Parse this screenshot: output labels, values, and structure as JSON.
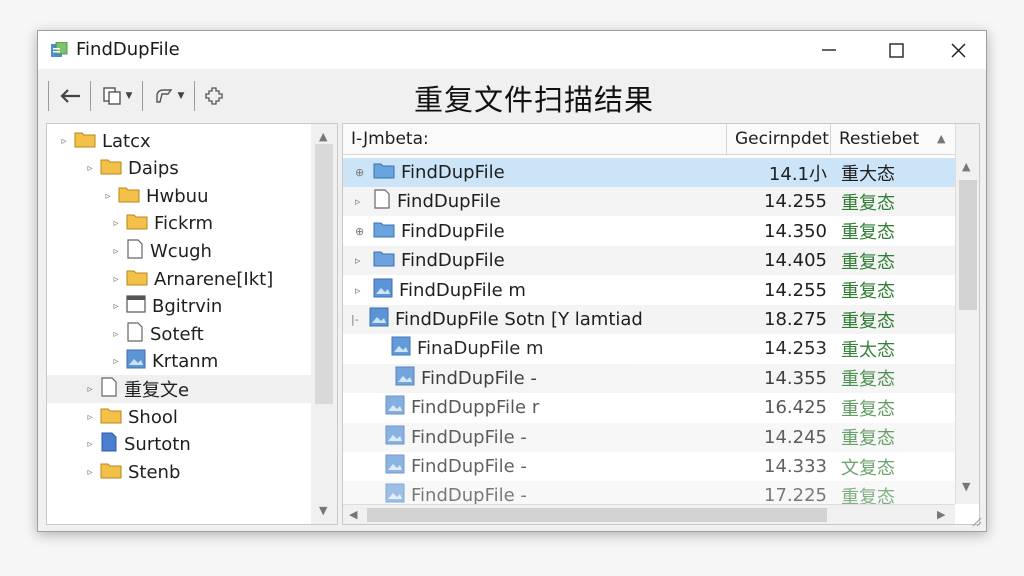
{
  "window": {
    "title": "FindDupFile"
  },
  "toolbar": {
    "heading": "重复文件扫描结果",
    "icons": [
      "back-icon",
      "copy-icon",
      "brush-icon",
      "settings-icon"
    ]
  },
  "tree": {
    "items": [
      {
        "label": "Latcx",
        "level": 0,
        "icon": "folder-icon"
      },
      {
        "label": "Daips",
        "level": 1,
        "icon": "folder-icon"
      },
      {
        "label": "Hwbuu",
        "level": 2,
        "icon": "folder-icon"
      },
      {
        "label": "Fickrm",
        "level": 3,
        "icon": "folder-icon"
      },
      {
        "label": "Wcugh",
        "level": 3,
        "icon": "file-icon"
      },
      {
        "label": "Arnarene[Ikt]",
        "level": 3,
        "icon": "folder-icon"
      },
      {
        "label": "Bgitrvin",
        "level": 3,
        "icon": "window-icon"
      },
      {
        "label": "Soteft",
        "level": 3,
        "icon": "file-icon"
      },
      {
        "label": "Krtanm",
        "level": 3,
        "icon": "image-file-icon"
      },
      {
        "label": "重复文e",
        "level": 1,
        "icon": "file-icon",
        "selected": true
      },
      {
        "label": "Shool",
        "level": 1,
        "icon": "folder-icon"
      },
      {
        "label": "Surtotn",
        "level": 1,
        "icon": "blue-file-icon"
      },
      {
        "label": "Stenb",
        "level": 1,
        "icon": "folder-icon"
      }
    ]
  },
  "list": {
    "columns": {
      "name": "I-Jmbeta:",
      "size": "Gecirnpdet",
      "status": "Restiebet"
    },
    "rows": [
      {
        "name": "FindDupFile",
        "size": "14.1小",
        "status": "重大态",
        "selected": true,
        "expander": "⊕",
        "icon": "folder-icon"
      },
      {
        "name": "FindDupFile",
        "size": "14.255",
        "status": "重复态",
        "expander": "▹",
        "icon": "file-icon"
      },
      {
        "name": "FindDupFile",
        "size": "14.350",
        "status": "重复态",
        "expander": "⊕",
        "icon": "folder-icon"
      },
      {
        "name": "FindDupFile",
        "size": "14.405",
        "status": "重复态",
        "expander": "▹",
        "icon": "folder-icon"
      },
      {
        "name": "FindDupFile m",
        "size": "14.255",
        "status": "重复态",
        "expander": "▹",
        "icon": "image-file-icon"
      },
      {
        "name": "FindDupFile Sotn [Y lamtiad",
        "size": "18.275",
        "status": "重复态",
        "expander": "|-",
        "icon": "image-file-icon"
      },
      {
        "name": "FinaDupFile m",
        "size": "14.253",
        "status": "重太态",
        "expander": "",
        "icon": "image-file-icon"
      },
      {
        "name": "FindDupFile -",
        "size": "14.355",
        "status": "重复态",
        "expander": "",
        "icon": "image-file-icon"
      },
      {
        "name": "FindDuppFile r",
        "size": "16.425",
        "status": "重复态",
        "expander": "",
        "icon": "image-file-icon"
      },
      {
        "name": "FindDupFile -",
        "size": "14.245",
        "status": "重复态",
        "expander": "",
        "icon": "image-file-icon"
      },
      {
        "name": "FindDupFile -",
        "size": "14.333",
        "status": "文复态",
        "expander": "",
        "icon": "image-file-icon"
      },
      {
        "name": "FindDupFile -",
        "size": "17.225",
        "status": "重复态",
        "expander": "",
        "icon": "image-file-icon"
      }
    ]
  },
  "colors": {
    "selection": "#cce4f7",
    "status_text": "#2e7d32",
    "folder": "#f3c04a"
  }
}
